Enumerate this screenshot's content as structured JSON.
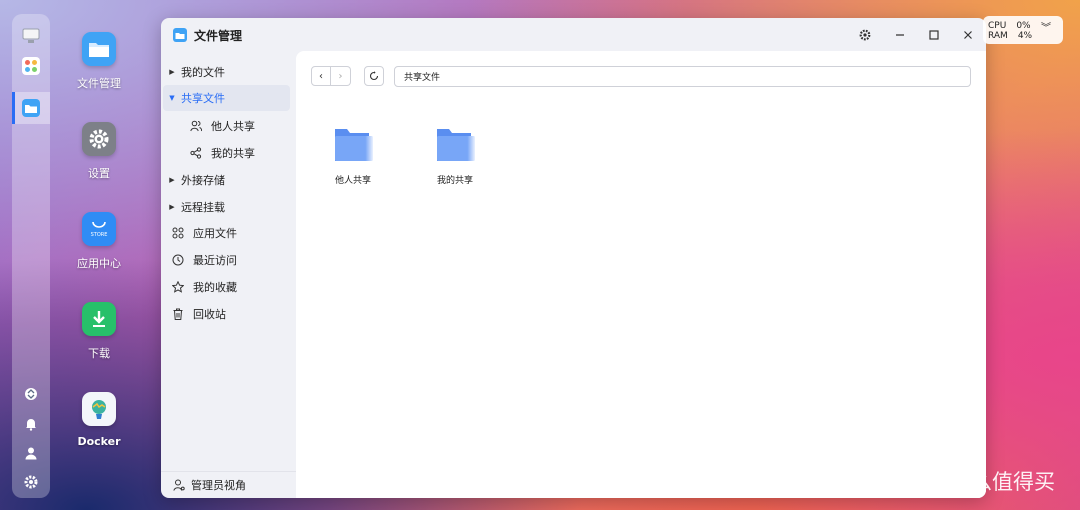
{
  "desktop": {
    "icons": [
      {
        "label": "文件管理"
      },
      {
        "label": "设置"
      },
      {
        "label": "应用中心",
        "badge": "STORE"
      },
      {
        "label": "下载"
      },
      {
        "label": "Docker"
      }
    ]
  },
  "window": {
    "title": "文件管理",
    "sidebar": {
      "items": [
        {
          "label": "我的文件",
          "icon": "caret-right-icon"
        },
        {
          "label": "共享文件",
          "icon": "caret-down-icon",
          "active": true
        },
        {
          "label": "他人共享",
          "icon": "users-icon"
        },
        {
          "label": "我的共享",
          "icon": "share-icon"
        },
        {
          "label": "外接存储",
          "icon": "caret-right-icon"
        },
        {
          "label": "远程挂载",
          "icon": "caret-right-icon"
        },
        {
          "label": "应用文件",
          "icon": "apps-icon"
        },
        {
          "label": "最近访问",
          "icon": "clock-icon"
        },
        {
          "label": "我的收藏",
          "icon": "star-icon"
        },
        {
          "label": "回收站",
          "icon": "trash-icon"
        }
      ],
      "footer": "管理员视角"
    },
    "address": "共享文件",
    "folders": [
      {
        "label": "他人共享"
      },
      {
        "label": "我的共享"
      }
    ]
  },
  "sysmon": {
    "cpu_label": "CPU",
    "cpu_value": "0%",
    "ram_label": "RAM",
    "ram_value": "4%"
  },
  "watermark": {
    "text": "什么值得买",
    "logo": "值"
  },
  "colors": {
    "accent": "#2a6df5",
    "folder": "#6f9ef5"
  }
}
